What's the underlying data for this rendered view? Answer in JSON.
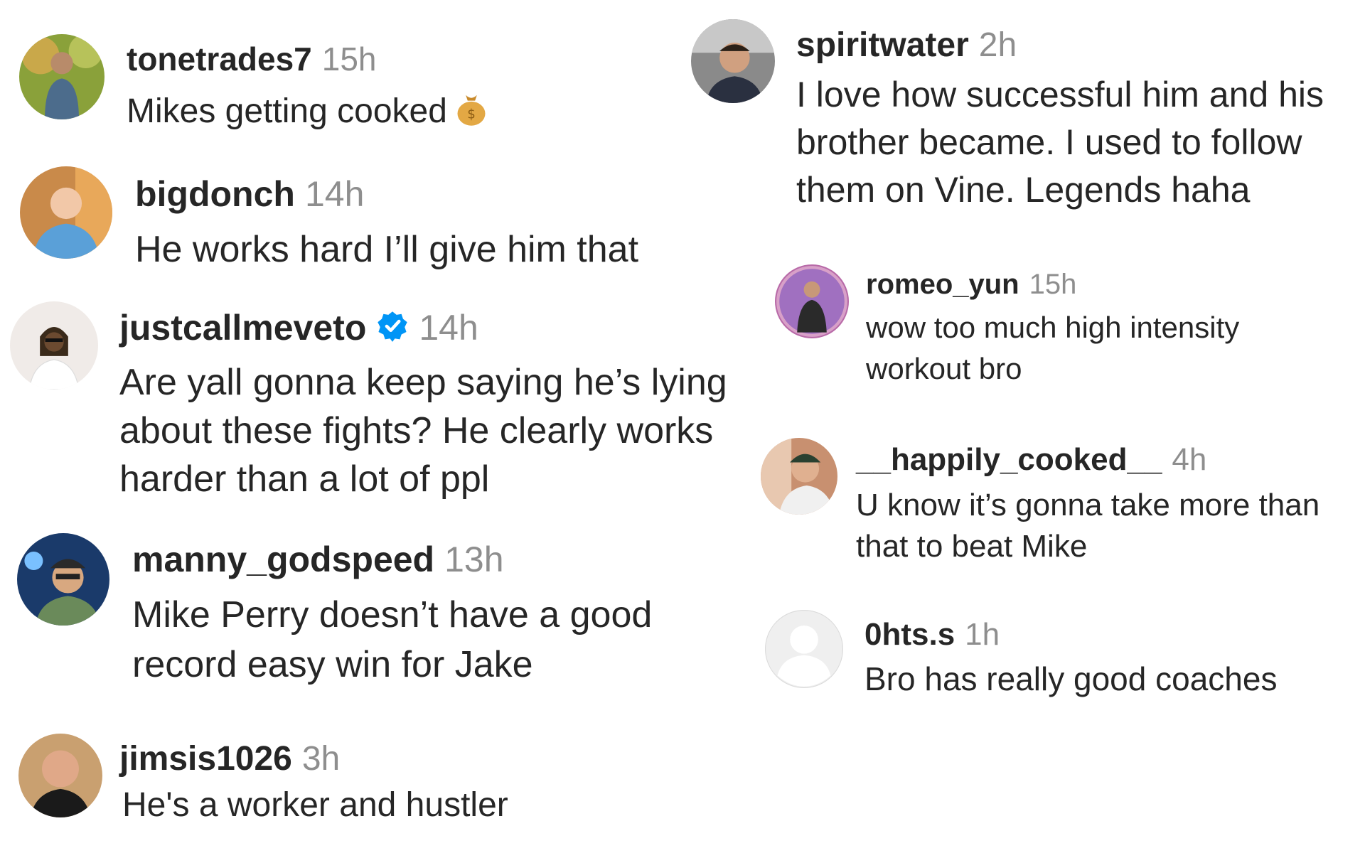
{
  "comments": [
    {
      "username": "tonetrades7",
      "time": "15h",
      "text": "Mikes getting cooked",
      "emoji": "money-bag-icon"
    },
    {
      "username": "bigdonch",
      "time": "14h",
      "text": "He works hard I’ll give him that"
    },
    {
      "username": "justcallmeveto",
      "time": "14h",
      "verified": true,
      "text": "Are yall gonna keep saying he’s lying about these fights? He clearly works harder than a lot of ppl"
    },
    {
      "username": "manny_godspeed",
      "time": "13h",
      "text": "Mike Perry doesn’t have a good record easy win for Jake"
    },
    {
      "username": "jimsis1026",
      "time": "3h",
      "text": "He's a worker and hustler"
    },
    {
      "username": "spiritwater",
      "time": "2h",
      "text": "I love how successful him and his brother became. I used to follow them on Vine. Legends haha"
    },
    {
      "username": "romeo_yun",
      "time": "15h",
      "text": "wow too much high intensity workout bro"
    },
    {
      "username": "__happily_cooked__",
      "time": "4h",
      "text": "U know it’s gonna take more than that to beat Mike"
    },
    {
      "username": "0hts.s",
      "time": "1h",
      "text": "Bro has really good coaches"
    }
  ],
  "colors": {
    "text": "#262626",
    "time": "#8e8e8e",
    "verified": "#0095f6",
    "placeholder_avatar": "#dbdbdb"
  }
}
